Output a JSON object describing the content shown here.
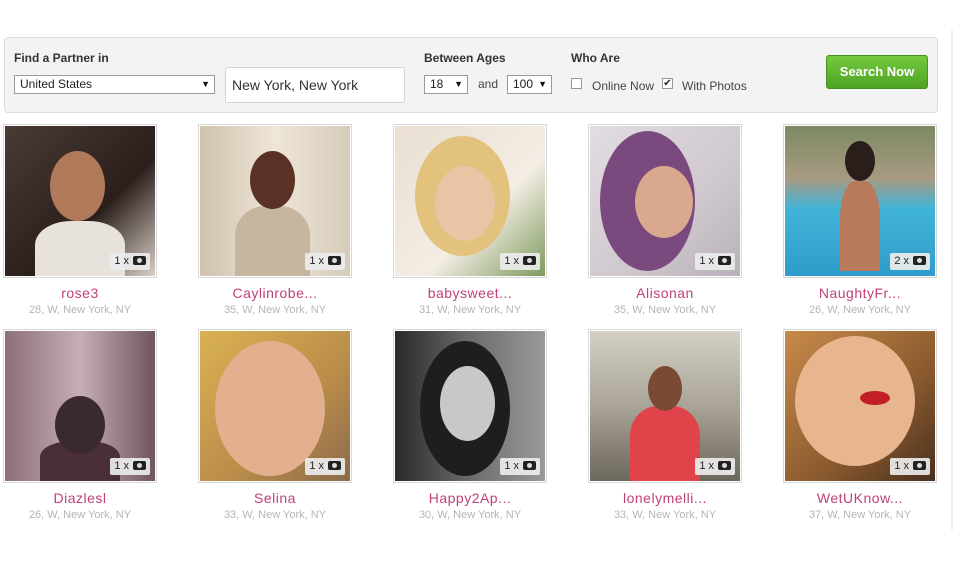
{
  "search": {
    "find_label": "Find a Partner in",
    "country": "United States",
    "city": "New York, New York",
    "ages_label": "Between Ages",
    "age_min": "18",
    "age_and": "and",
    "age_max": "100",
    "who_label": "Who Are",
    "online_now_label": "Online Now",
    "online_now_checked": false,
    "with_photos_label": "With Photos",
    "with_photos_checked": true,
    "button_label": "Search Now",
    "button_color": "#5cb130"
  },
  "accent_color": "#c0407b",
  "profiles": [
    {
      "name": "rose3",
      "meta": "28, W, New York, NY",
      "photos": "1 x"
    },
    {
      "name": "Caylinrobe...",
      "meta": "35, W, New York, NY",
      "photos": "1 x"
    },
    {
      "name": "babysweet...",
      "meta": "31, W, New York, NY",
      "photos": "1 x"
    },
    {
      "name": "Alisonan",
      "meta": "35, W, New York, NY",
      "photos": "1 x"
    },
    {
      "name": "NaughtyFr...",
      "meta": "26, W, New York, NY",
      "photos": "2 x"
    },
    {
      "name": "Diazlesl",
      "meta": "26, W, New York, NY",
      "photos": "1 x"
    },
    {
      "name": "Selina",
      "meta": "33, W, New York, NY",
      "photos": "1 x"
    },
    {
      "name": "Happy2Ap...",
      "meta": "30, W, New York, NY",
      "photos": "1 x"
    },
    {
      "name": "lonelymelli...",
      "meta": "33, W, New York, NY",
      "photos": "1 x"
    },
    {
      "name": "WetUKnow...",
      "meta": "37, W, New York, NY",
      "photos": "1 x"
    }
  ]
}
